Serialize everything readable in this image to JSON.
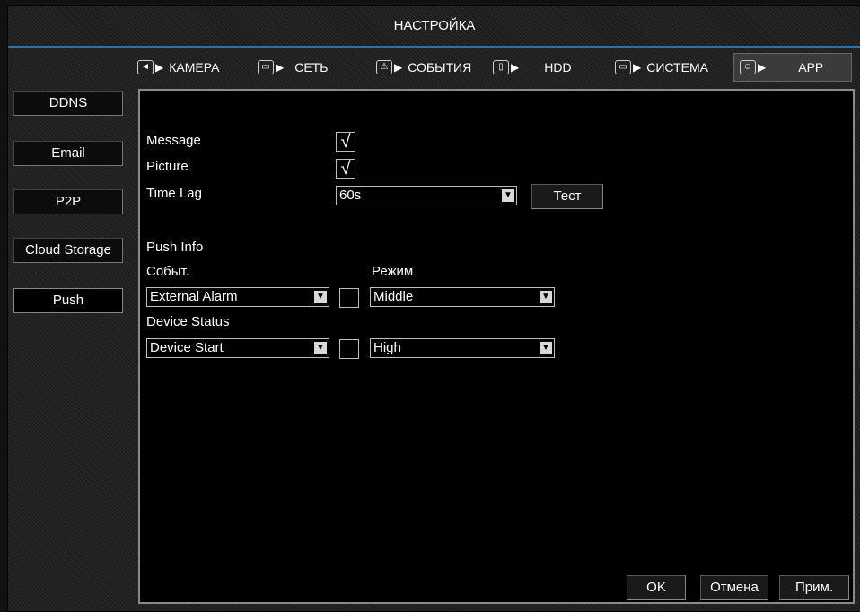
{
  "title": "НАСТРОЙКА",
  "tabs": [
    {
      "label": "КАМЕРА",
      "icon": "camera-icon"
    },
    {
      "label": "СЕТЬ",
      "icon": "network-icon"
    },
    {
      "label": "СОБЫТИЯ",
      "icon": "warning-icon"
    },
    {
      "label": "HDD",
      "icon": "hdd-icon"
    },
    {
      "label": "СИСТЕМА",
      "icon": "monitor-icon"
    },
    {
      "label": "APP",
      "icon": "app-icon"
    }
  ],
  "sidebar": {
    "items": [
      {
        "label": "DDNS"
      },
      {
        "label": "Email"
      },
      {
        "label": "P2P"
      },
      {
        "label": "Cloud Storage"
      },
      {
        "label": "Push"
      }
    ],
    "active": "Push"
  },
  "form": {
    "message_label": "Message",
    "message_checked": true,
    "picture_label": "Picture",
    "picture_checked": true,
    "timelag_label": "Time Lag",
    "timelag_value": "60s",
    "test_button": "Тест",
    "pushinfo_label": "Push Info",
    "event_label": "Событ.",
    "mode_label": "Режим",
    "event_value": "External Alarm",
    "event_checked": false,
    "event_mode_value": "Middle",
    "device_status_label": "Device Status",
    "device_status_value": "Device Start",
    "device_checked": false,
    "device_mode_value": "High"
  },
  "footer": {
    "ok": "OK",
    "cancel": "Отмена",
    "apply": "Прим."
  },
  "colors": {
    "accent_line": "#2f6fa8",
    "panel_border": "#8a8a8a"
  }
}
